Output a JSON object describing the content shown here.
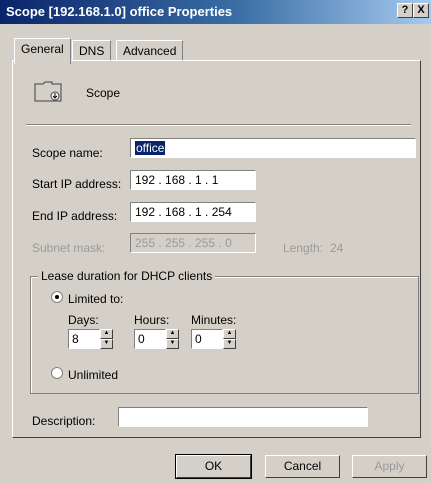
{
  "window": {
    "title": "Scope [192.168.1.0] office Properties",
    "help_btn": "?",
    "close_btn": "X"
  },
  "tabs": [
    {
      "label": "General"
    },
    {
      "label": "DNS"
    },
    {
      "label": "Advanced"
    }
  ],
  "header": {
    "icon": "folder-icon",
    "label": "Scope"
  },
  "fields": {
    "scope_name": {
      "label": "Scope name:",
      "value": "office"
    },
    "start_ip": {
      "label": "Start IP address:",
      "value": "192 . 168 .  1  .  1"
    },
    "end_ip": {
      "label": "End IP address:",
      "value": "192 . 168 .  1  . 254"
    },
    "subnet": {
      "label": "Subnet mask:",
      "value": "255 . 255 . 255 .  0",
      "length_label": "Length:",
      "length_value": "24"
    }
  },
  "lease": {
    "title": "Lease duration for DHCP clients",
    "limited_label": "Limited to:",
    "days_label": "Days:",
    "days_value": "8",
    "hours_label": "Hours:",
    "hours_value": "0",
    "minutes_label": "Minutes:",
    "minutes_value": "0",
    "unlimited_label": "Unlimited"
  },
  "description": {
    "label": "Description:",
    "value": ""
  },
  "buttons": {
    "ok": "OK",
    "cancel": "Cancel",
    "apply": "Apply"
  }
}
